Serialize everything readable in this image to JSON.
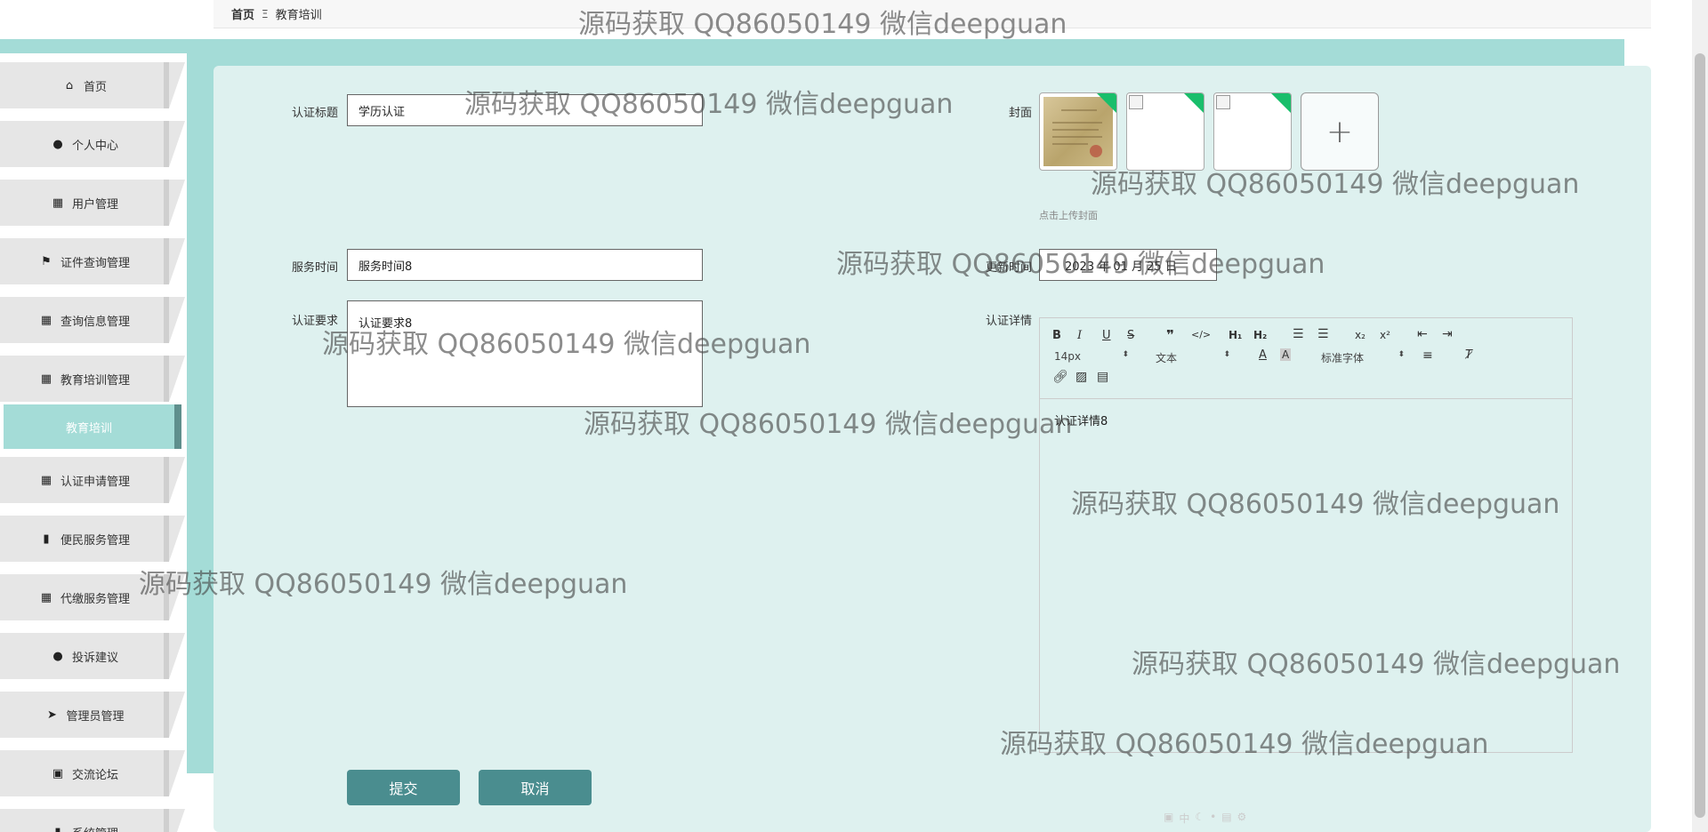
{
  "breadcrumb": {
    "home": "首页",
    "separator": "Ξ",
    "current": "教育培训"
  },
  "sidebar": {
    "items": [
      {
        "label": "首页",
        "icon": "home-icon",
        "glyph": "⌂"
      },
      {
        "label": "个人中心",
        "icon": "user-icon",
        "glyph": "●"
      },
      {
        "label": "用户管理",
        "icon": "grid-icon",
        "glyph": "▦"
      },
      {
        "label": "证件查询管理",
        "icon": "flag-icon",
        "glyph": "⚑"
      },
      {
        "label": "查询信息管理",
        "icon": "grid-icon",
        "glyph": "▦"
      },
      {
        "label": "教育培训管理",
        "icon": "grid-icon",
        "glyph": "▦"
      },
      {
        "label": "认证申请管理",
        "icon": "grid-icon",
        "glyph": "▦"
      },
      {
        "label": "便民服务管理",
        "icon": "bar-chart-icon",
        "glyph": "▮"
      },
      {
        "label": "代缴服务管理",
        "icon": "grid-icon",
        "glyph": "▦"
      },
      {
        "label": "投诉建议",
        "icon": "user-icon",
        "glyph": "●"
      },
      {
        "label": "管理员管理",
        "icon": "send-icon",
        "glyph": "➤"
      },
      {
        "label": "交流论坛",
        "icon": "clipboard-icon",
        "glyph": "▣"
      },
      {
        "label": "系统管理",
        "icon": "bar-chart-icon",
        "glyph": "▮"
      }
    ],
    "active_sub": "教育培训"
  },
  "form": {
    "title_label": "认证标题",
    "title_value": "学历认证",
    "cover_label": "封面",
    "cover_hint": "点击上传封面",
    "upload_plus": "+",
    "service_time_label": "服务时间",
    "service_time_value": "服务时间8",
    "update_time_label": "更新时间",
    "update_time_value": "2023 年 01 月 25 日",
    "requirement_label": "认证要求",
    "requirement_value": "认证要求8",
    "detail_label": "认证详情",
    "detail_value": "认证详情8",
    "submit_label": "提交",
    "cancel_label": "取消"
  },
  "editor": {
    "font_size": "14px",
    "text_type": "文本",
    "font_family": "标准字体"
  },
  "colors": {
    "teal": "#a4dcd7",
    "panel": "#def1ef",
    "button": "#4a8d8f",
    "upload_corner": "#19be6b"
  },
  "watermark": "源码获取 QQ86050149 微信deepguan"
}
